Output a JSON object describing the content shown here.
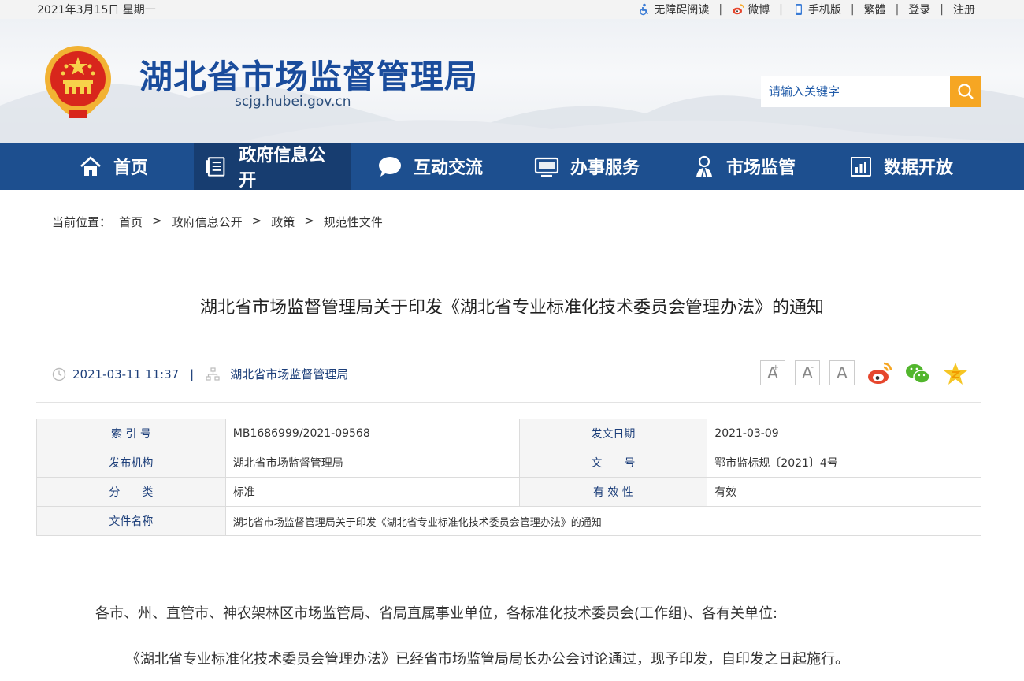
{
  "topbar": {
    "date": "2021年3月15日 星期一",
    "links": [
      "无障碍阅读",
      "微博",
      "手机版",
      "繁體",
      "登录",
      "注册"
    ]
  },
  "header": {
    "title": "湖北省市场监督管理局",
    "domain": "scjg.hubei.gov.cn",
    "search_placeholder": "请输入关键字"
  },
  "nav": {
    "items": [
      "首页",
      "政府信息公开",
      "互动交流",
      "办事服务",
      "市场监管",
      "数据开放"
    ],
    "active_index": 1
  },
  "breadcrumb": {
    "label": "当前位置：",
    "items": [
      "首页",
      "政府信息公开",
      "政策",
      "规范性文件"
    ],
    "separator": ">"
  },
  "article": {
    "title": "湖北省市场监督管理局关于印发《湖北省专业标准化技术委员会管理办法》的通知",
    "datetime": "2021-03-11 11:37",
    "meta_sep": "|",
    "source": "湖北省市场监督管理局",
    "font_sizes": [
      "A",
      "A",
      "A"
    ],
    "font_marks": [
      "+",
      "-",
      ""
    ],
    "share": [
      "weibo-icon",
      "wechat-icon",
      "qzone-icon"
    ]
  },
  "info_table": {
    "rows": [
      [
        {
          "k": "索 引 号",
          "v": "MB1686999/2021-09568"
        },
        {
          "k": "发文日期",
          "v": "2021-03-09"
        }
      ],
      [
        {
          "k": "发布机构",
          "v": "湖北省市场监督管理局"
        },
        {
          "k": "文　　号",
          "v": "鄂市监标规〔2021〕4号"
        }
      ],
      [
        {
          "k": "分　　类",
          "v": "标准"
        },
        {
          "k": "有 效 性",
          "v": "有效"
        }
      ]
    ],
    "file_name_label": "文件名称",
    "file_name": "湖北省市场监督管理局关于印发《湖北省专业标准化技术委员会管理办法》的通知"
  },
  "body": {
    "p1": "各市、州、直管市、神农架林区市场监管局、省局直属事业单位，各标准化技术委员会(工作组)、各有关单位:",
    "p2": "《湖北省专业标准化技术委员会管理办法》已经省市场监管局局长办公会讨论通过，现予印发，自印发之日起施行。"
  },
  "colors": {
    "nav_bg": "#1d4f8f",
    "nav_active": "#173d70",
    "title_blue": "#1a4c9c",
    "search_btn": "#f6a623"
  }
}
